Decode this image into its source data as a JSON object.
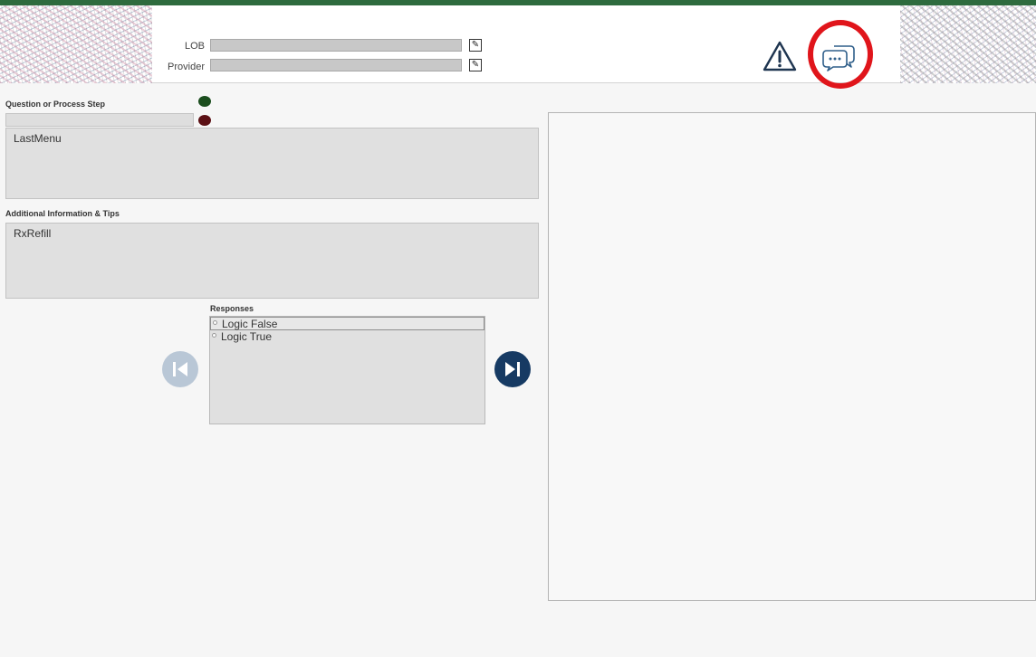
{
  "header": {
    "lob_label": "LOB",
    "lob_value": "",
    "provider_label": "Provider",
    "provider_value": "",
    "edit_glyph": "✎",
    "icons": [
      "warning-triangle-icon",
      "chat-bubbles-icon"
    ],
    "highlight_color": "#e0151b",
    "brand_green": "#2e6b3e"
  },
  "question": {
    "label": "Question or Process Step",
    "small_field_value": "",
    "text": "LastMenu"
  },
  "info": {
    "label": "Additional Information & Tips",
    "text": "RxRefill"
  },
  "responses": {
    "label": "Responses",
    "items": [
      {
        "label": "Logic False",
        "selected": true
      },
      {
        "label": "Logic True",
        "selected": false
      }
    ]
  },
  "nav": {
    "prev_icon": "skip-previous-icon",
    "next_icon": "skip-next-icon",
    "next_color": "#163a63",
    "prev_color": "#b9c7d6"
  }
}
